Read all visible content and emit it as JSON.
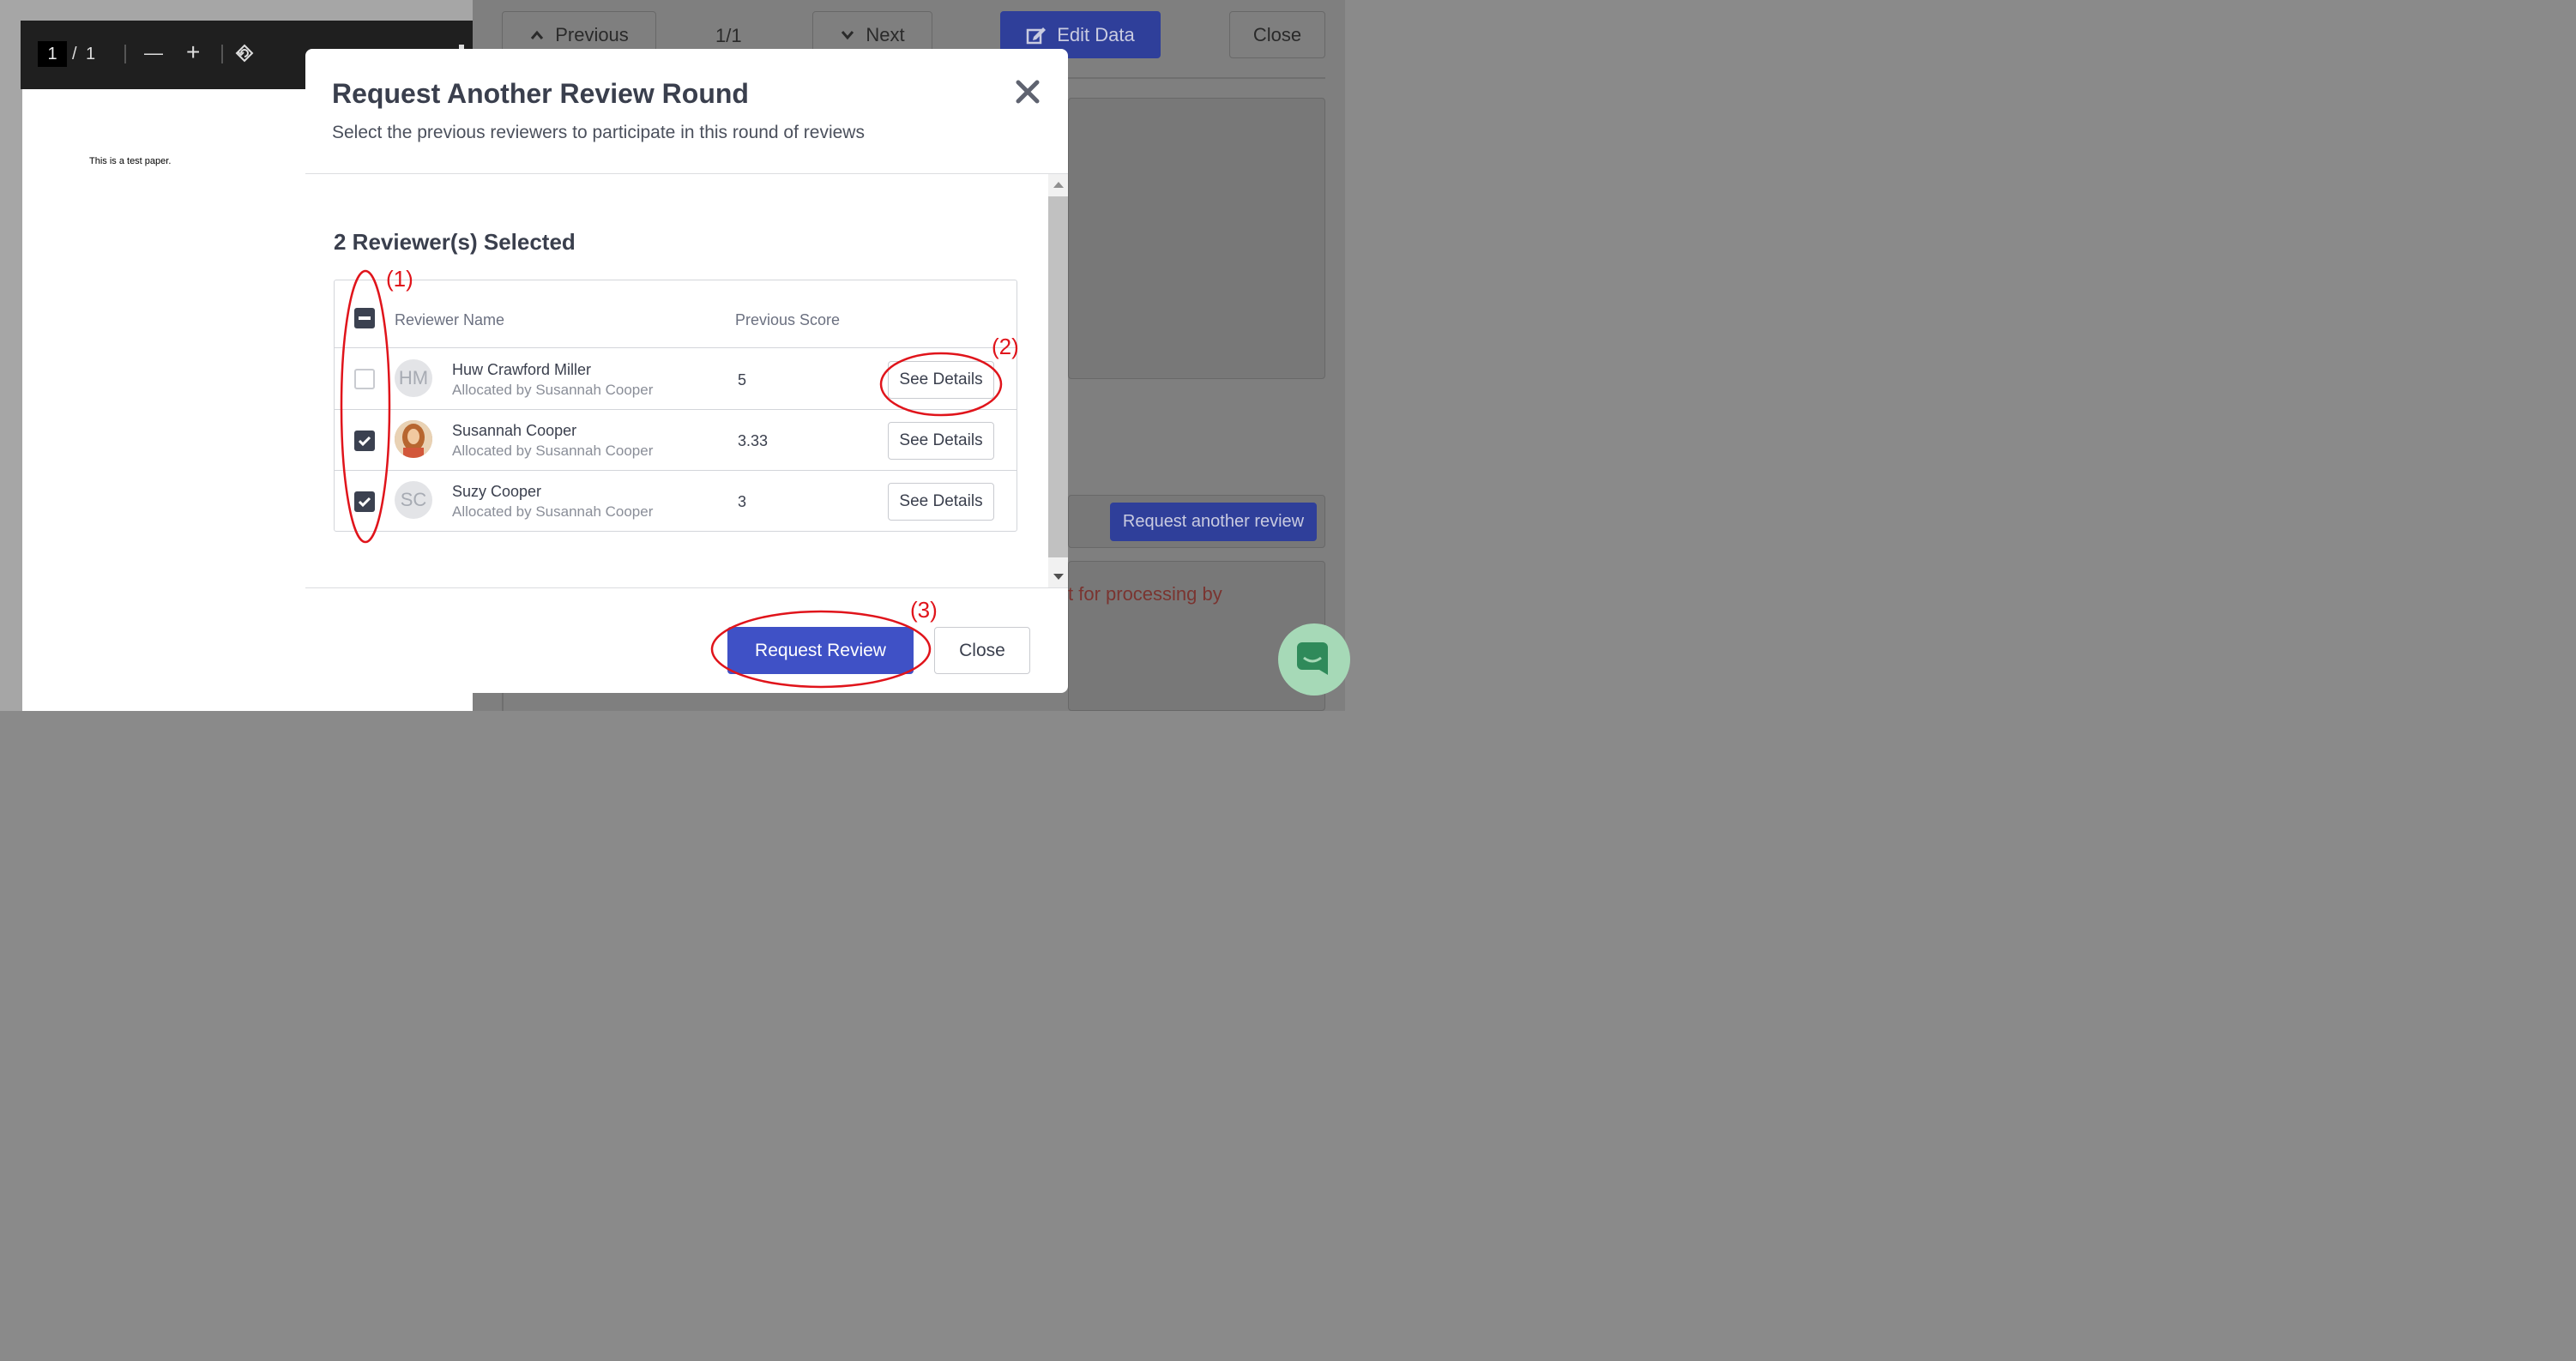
{
  "pdf_viewer": {
    "page_current": "1",
    "page_separator": "/",
    "page_total": "1",
    "zoom_out_symbol": "—",
    "zoom_in_symbol": "+",
    "page_text": "This is a test paper."
  },
  "background": {
    "previous_label": "Previous",
    "page_counter": "1/1",
    "next_label": "Next",
    "edit_data_label": "Edit Data",
    "close_label": "Close",
    "request_another_review_label": "Request another review",
    "processing_text_fragment": "t for processing by"
  },
  "modal": {
    "title": "Request Another Review Round",
    "subtitle": "Select the previous reviewers to participate in this round of reviews",
    "selected_count": "2 Reviewer(s) Selected",
    "table": {
      "col_name": "Reviewer Name",
      "col_score": "Previous Score",
      "rows": [
        {
          "initials": "HM",
          "name": "Huw Crawford Miller",
          "allocated": "Allocated by Susannah Cooper",
          "score": "5",
          "checked": false,
          "details_label": "See Details"
        },
        {
          "initials": "",
          "name": "Susannah Cooper",
          "allocated": "Allocated by Susannah Cooper",
          "score": "3.33",
          "checked": true,
          "details_label": "See Details"
        },
        {
          "initials": "SC",
          "name": "Suzy Cooper",
          "allocated": "Allocated by Susannah Cooper",
          "score": "3",
          "checked": true,
          "details_label": "See Details"
        }
      ]
    },
    "request_review_label": "Request Review",
    "close_label": "Close"
  },
  "annotations": {
    "label_1": "(1)",
    "label_2": "(2)",
    "label_3": "(3)",
    "color": "#e0141b"
  },
  "colors": {
    "primary": "#3f51c6",
    "checkbox_dark": "#3b4150",
    "text_dark": "#3a3f4d"
  },
  "icons": [
    "rotate-icon",
    "chevron-up-icon",
    "chevron-down-icon",
    "edit-icon",
    "close-x-icon",
    "check-icon",
    "minus-icon",
    "chat-icon"
  ]
}
